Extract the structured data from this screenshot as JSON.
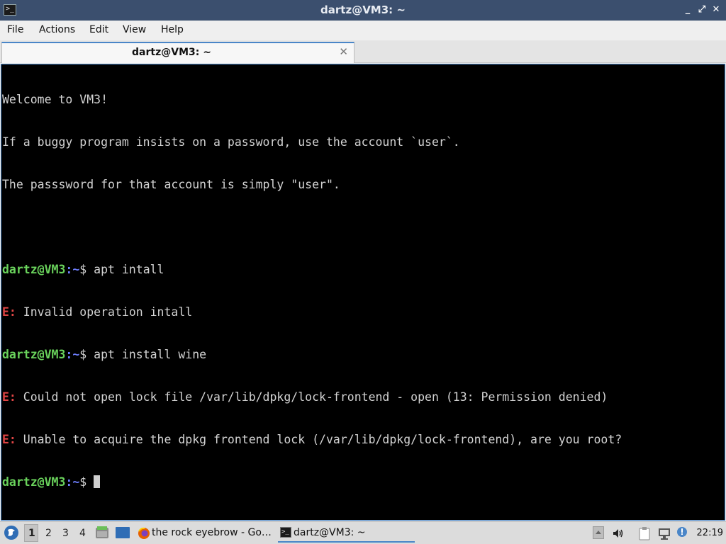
{
  "window": {
    "title": "dartz@VM3: ~"
  },
  "menubar": {
    "items": [
      "File",
      "Actions",
      "Edit",
      "View",
      "Help"
    ]
  },
  "tab": {
    "label": "dartz@VM3: ~"
  },
  "terminal": {
    "welcome": "Welcome to VM3!",
    "info1": "If a buggy program insists on a password, use the account `user`.",
    "info2": "The passsword for that account is simply \"user\".",
    "prompt_user": "dartz@VM3",
    "prompt_path": ":~",
    "prompt_symbol": "$ ",
    "cmd1": "apt intall",
    "err_prefix": "E:",
    "err1": " Invalid operation intall",
    "cmd2": "apt install wine",
    "err2": " Could not open lock file /var/lib/dpkg/lock-frontend - open (13: Permission denied)",
    "err3": " Unable to acquire the dpkg frontend lock (/var/lib/dpkg/lock-frontend), are you root?"
  },
  "taskbar": {
    "desktops": [
      "1",
      "2",
      "3",
      "4"
    ],
    "tasks": [
      "the rock eyebrow - Go…",
      "dartz@VM3: ~"
    ],
    "clock": "22:19"
  }
}
